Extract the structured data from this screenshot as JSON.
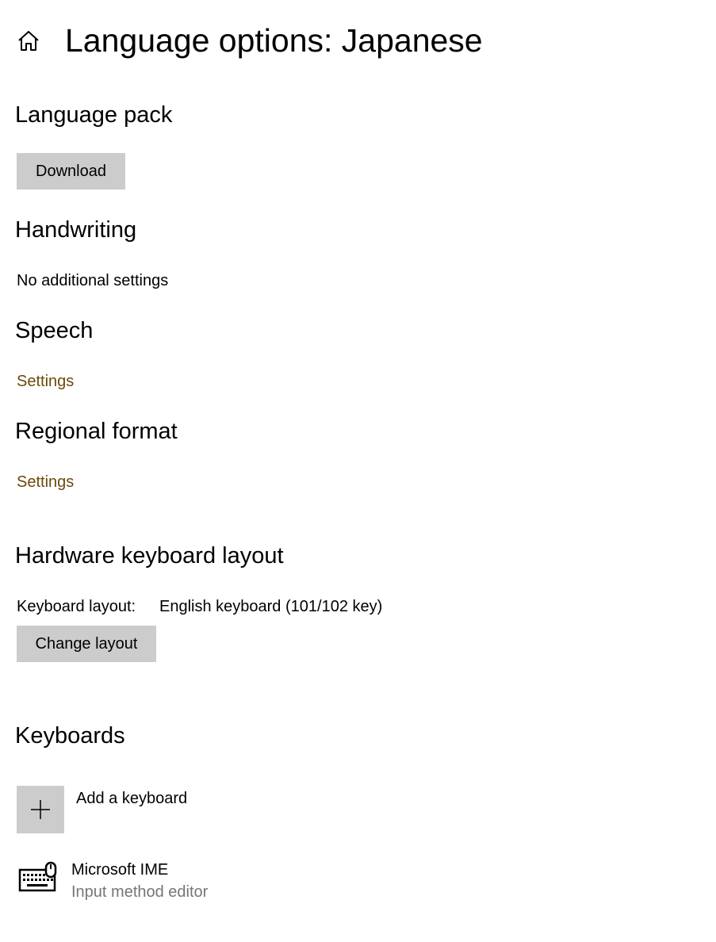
{
  "header": {
    "title": "Language options: Japanese",
    "home_icon": "home-icon"
  },
  "language_pack": {
    "heading": "Language pack",
    "download_label": "Download"
  },
  "handwriting": {
    "heading": "Handwriting",
    "note": "No additional settings"
  },
  "speech": {
    "heading": "Speech",
    "settings_link": "Settings"
  },
  "regional_format": {
    "heading": "Regional format",
    "settings_link": "Settings"
  },
  "hardware_keyboard": {
    "heading": "Hardware keyboard layout",
    "layout_label": "Keyboard layout:",
    "layout_value": "English keyboard (101/102 key)",
    "change_button": "Change layout"
  },
  "keyboards": {
    "heading": "Keyboards",
    "add_label": "Add a keyboard",
    "add_icon": "plus-icon",
    "items": [
      {
        "name": "Microsoft IME",
        "description": "Input method editor",
        "icon": "keyboard-icon"
      }
    ]
  },
  "colors": {
    "link": "#6b4a0a",
    "button_bg": "#cccccc",
    "secondary_text": "#767676"
  }
}
